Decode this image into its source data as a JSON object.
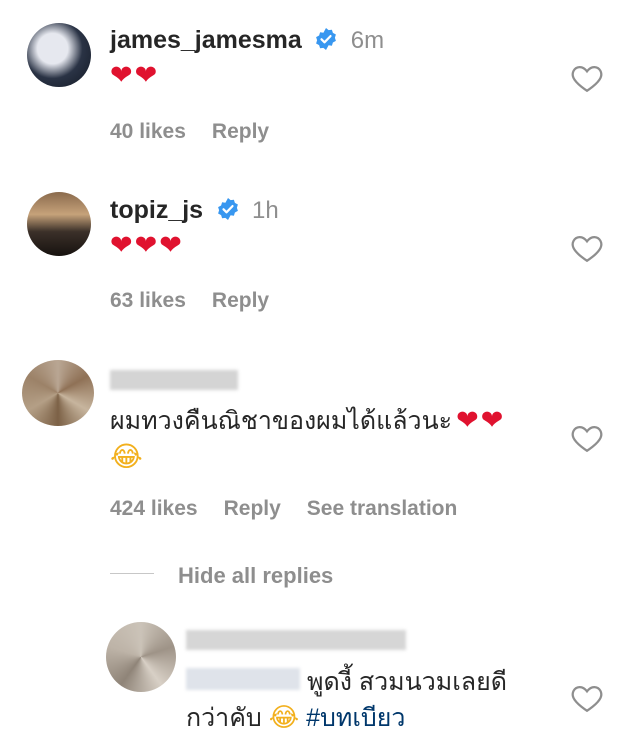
{
  "comments": [
    {
      "username": "james_jamesma",
      "verified": true,
      "time": "6m",
      "text": "❤❤",
      "likes": "40 likes",
      "reply": "Reply"
    },
    {
      "username": "topiz_js",
      "verified": true,
      "time": "1h",
      "text": "❤❤❤",
      "likes": "63 likes",
      "reply": "Reply"
    },
    {
      "username_blurred": true,
      "text_line1": "ผมทวงคืนณิชาของผมได้แล้วนะ",
      "text_emoji_hearts": "❤❤",
      "text_line2_emoji": "😂",
      "likes": "424 likes",
      "reply": "Reply",
      "see_translation": "See translation",
      "hide_replies": "Hide all replies"
    },
    {
      "username_blurred": true,
      "mention_blurred": true,
      "text_line1": "พูดงี้ สวมนวมเลยดี",
      "text_line2": "กว่าคับ",
      "emoji": "😂",
      "hashtag": "#บทเบียว"
    }
  ],
  "colors": {
    "heart": "#e0122f",
    "verified": "#3897f0",
    "meta": "#8e8e8e",
    "hashtag": "#00376b"
  },
  "icons": {
    "like": "heart-outline-icon",
    "verified": "verified-badge-icon"
  }
}
